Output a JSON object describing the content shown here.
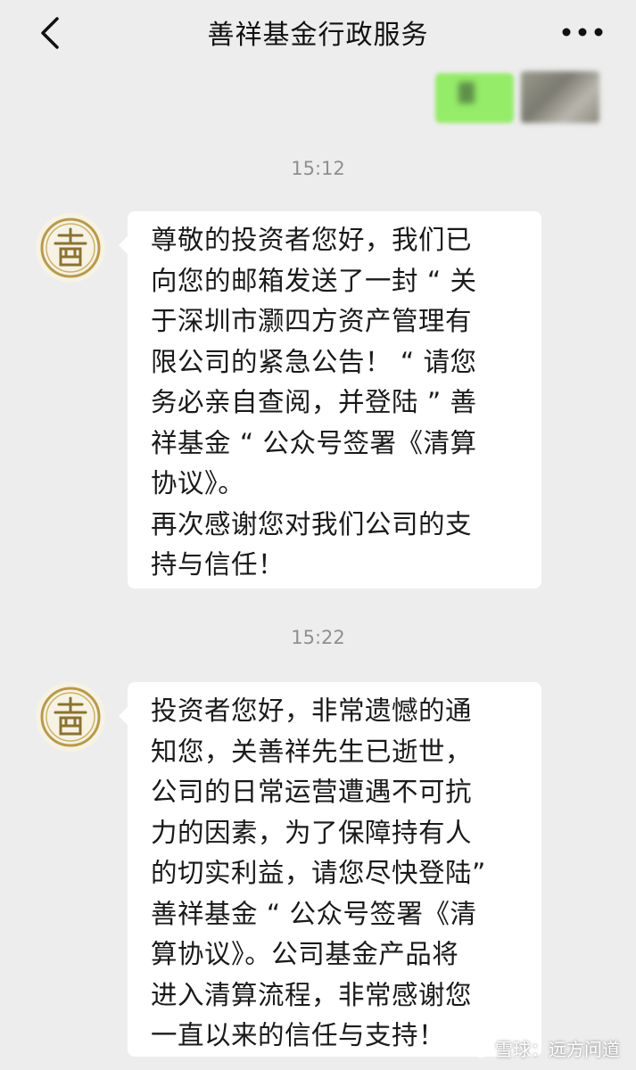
{
  "header": {
    "title": "善祥基金行政服务"
  },
  "messages": [
    {
      "timestamp": "15:12",
      "lines": [
        "尊敬的投资者您好，我们已",
        "向您的邮箱发送了一封 “ 关",
        "于深圳市灏四方资产管理有",
        "限公司的紧急公告！ “ 请您",
        "务必亲自查阅，并登陆 ” 善",
        "祥基金 “ 公众号签署《清算",
        "协议》。",
        "再次感谢您对我们公司的支",
        "持与信任！"
      ]
    },
    {
      "timestamp": "15:22",
      "lines": [
        "投资者您好，非常遗憾的通",
        "知您，关善祥先生已逝世，",
        "公司的日常运营遭遇不可抗",
        "力的因素，为了保障持有人",
        "的切实利益，请您尽快登陆”",
        "善祥基金 “ 公众号签署《清",
        "算协议》。公司基金产品将",
        "进入清算流程，非常感谢您",
        "一直以来的信任与支持！"
      ]
    }
  ],
  "watermark": {
    "text": "雪球：远方问道"
  },
  "icons": {
    "back": "chevron-left-icon",
    "more": "more-dots-icon",
    "avatar": "shan-seal-avatar-icon"
  },
  "colors": {
    "background": "#ededed",
    "bubble": "#ffffff",
    "outgoing_bubble": "#95ec69",
    "timestamp": "#8f8f8f"
  }
}
